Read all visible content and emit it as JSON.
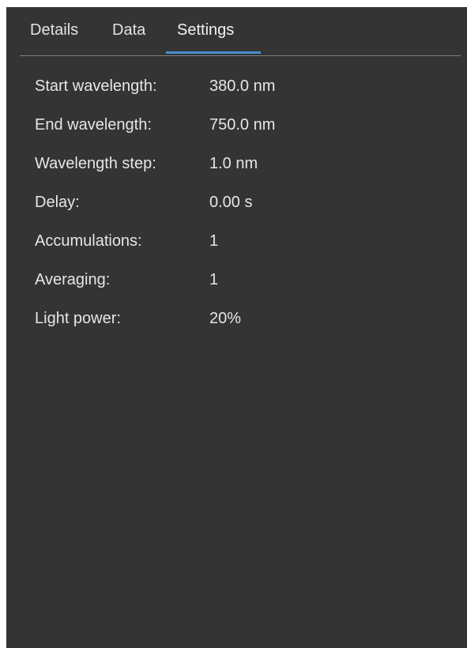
{
  "tabs": [
    {
      "label": "Details",
      "active": false
    },
    {
      "label": "Data",
      "active": false
    },
    {
      "label": "Settings",
      "active": true
    }
  ],
  "colors": {
    "panel_background": "#343434",
    "text": "#e6e6e6",
    "active_tab_underline": "#4a8ed0",
    "divider": "#808080"
  },
  "settings": [
    {
      "label": "Start wavelength:",
      "value": "380.0 nm"
    },
    {
      "label": "End wavelength:",
      "value": "750.0 nm"
    },
    {
      "label": "Wavelength step:",
      "value": "1.0 nm"
    },
    {
      "label": "Delay:",
      "value": "0.00 s"
    },
    {
      "label": "Accumulations:",
      "value": "1"
    },
    {
      "label": "Averaging:",
      "value": "1"
    },
    {
      "label": "Light power:",
      "value": "20%"
    }
  ]
}
